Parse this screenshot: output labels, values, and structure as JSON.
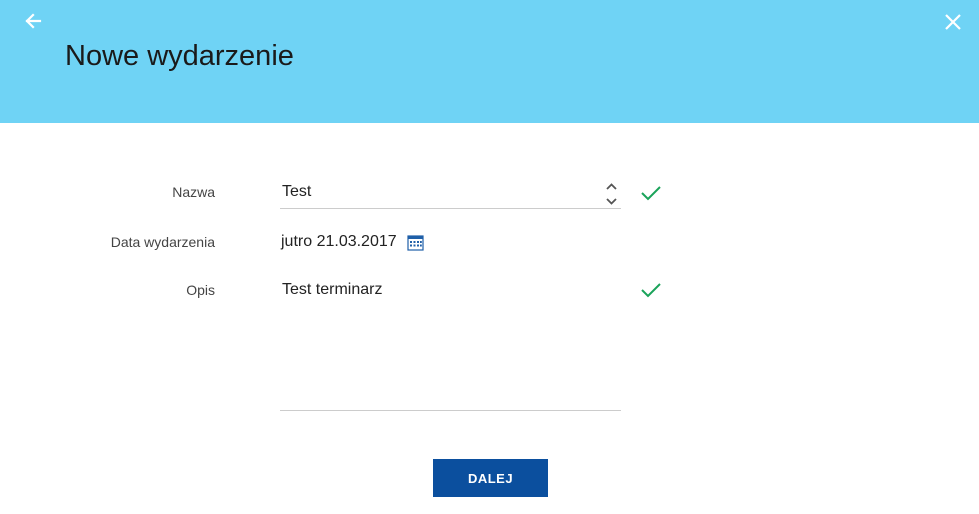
{
  "header": {
    "title": "Nowe wydarzenie",
    "background_color": "#6fd3f5",
    "back_icon": "arrow-left-icon",
    "close_icon": "close-icon"
  },
  "form": {
    "name": {
      "label": "Nazwa",
      "value": "Test",
      "valid": true
    },
    "date": {
      "label": "Data wydarzenia",
      "value": "jutro 21.03.2017",
      "icon": "calendar-icon"
    },
    "description": {
      "label": "Opis",
      "value": "Test terminarz",
      "valid": true
    },
    "valid_color": "#1aa35a"
  },
  "actions": {
    "next_label": "DALEJ",
    "next_color": "#0b4f9e"
  }
}
